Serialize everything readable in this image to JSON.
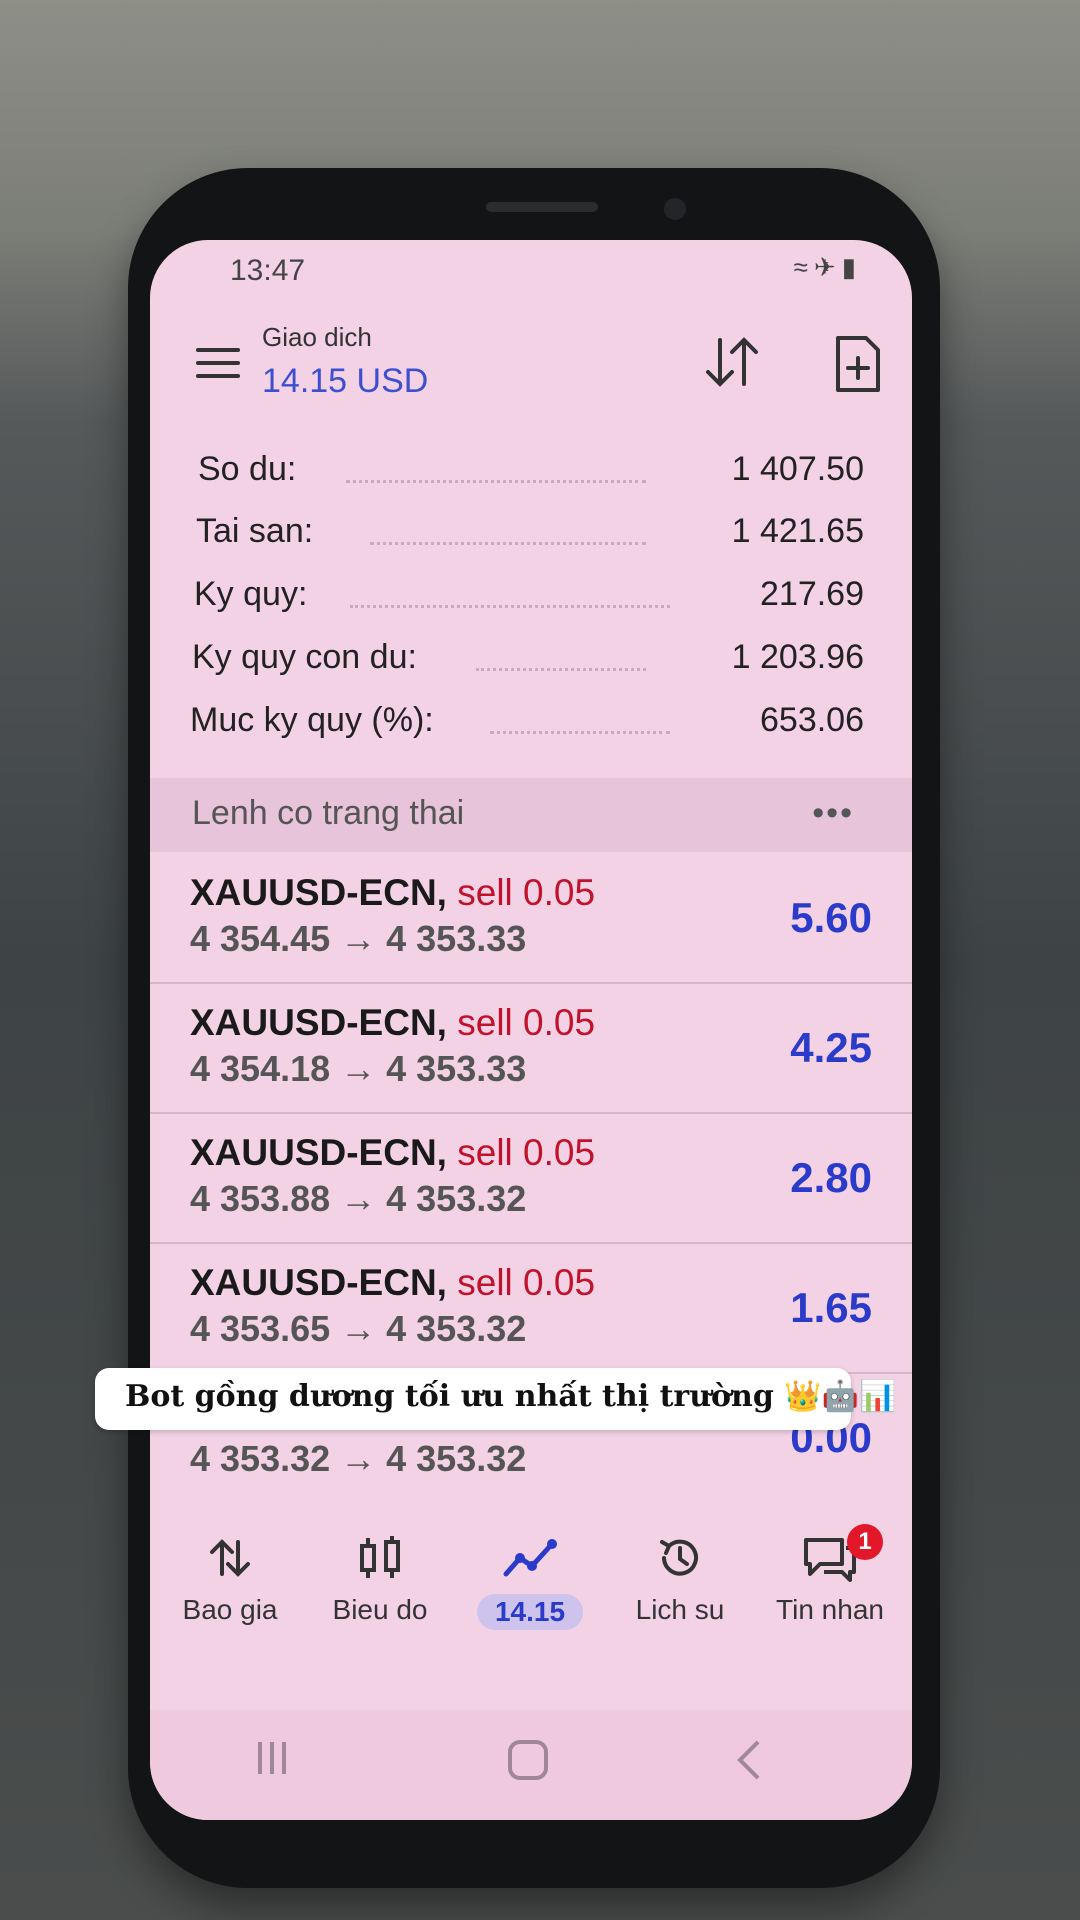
{
  "status_bar": {
    "time": "13:47",
    "icons": [
      "wifi-icon",
      "airplane-icon",
      "battery-icon"
    ]
  },
  "header": {
    "subtitle": "Giao dich",
    "title": "14.15 USD"
  },
  "account": [
    {
      "label": "So du:",
      "value": "1 407.50"
    },
    {
      "label": "Tai san:",
      "value": "1 421.65"
    },
    {
      "label": "Ky quy:",
      "value": "217.69"
    },
    {
      "label": "Ky quy con du:",
      "value": "1 203.96"
    },
    {
      "label": "Muc ky quy (%):",
      "value": "653.06"
    }
  ],
  "orders_section": {
    "title": "Lenh co trang thai",
    "more": "•••"
  },
  "orders": [
    {
      "symbol": "XAUUSD-ECN,",
      "side": "sell 0.05",
      "prices": "4 354.45 → 4 353.33",
      "profit": "5.60"
    },
    {
      "symbol": "XAUUSD-ECN,",
      "side": "sell 0.05",
      "prices": "4 354.18 → 4 353.33",
      "profit": "4.25"
    },
    {
      "symbol": "XAUUSD-ECN,",
      "side": "sell 0.05",
      "prices": "4 353.88 → 4 353.32",
      "profit": "2.80"
    },
    {
      "symbol": "XAUUSD-ECN,",
      "side": "sell 0.05",
      "prices": "4 353.65 → 4 353.32",
      "profit": "1.65"
    },
    {
      "symbol": "",
      "side": "",
      "prices": "4 353.32 → 4 353.32",
      "profit": "0.00"
    }
  ],
  "caption": {
    "text": "Bot gồng dương tối ưu nhất thị trường 👑🤖📊"
  },
  "bottom_nav": [
    {
      "label": "Bao gia",
      "icon": "quotes-icon"
    },
    {
      "label": "Bieu do",
      "icon": "chart-icon"
    },
    {
      "label": "14.15",
      "icon": "trade-icon",
      "active": true
    },
    {
      "label": "Lich su",
      "icon": "history-icon"
    },
    {
      "label": "Tin nhan",
      "icon": "messages-icon",
      "badge": "1"
    }
  ],
  "colors": {
    "accent": "#2a3bc9",
    "sell": "#c1122b",
    "badge": "#e2182a",
    "screen_bg": "#f4d2e6"
  }
}
